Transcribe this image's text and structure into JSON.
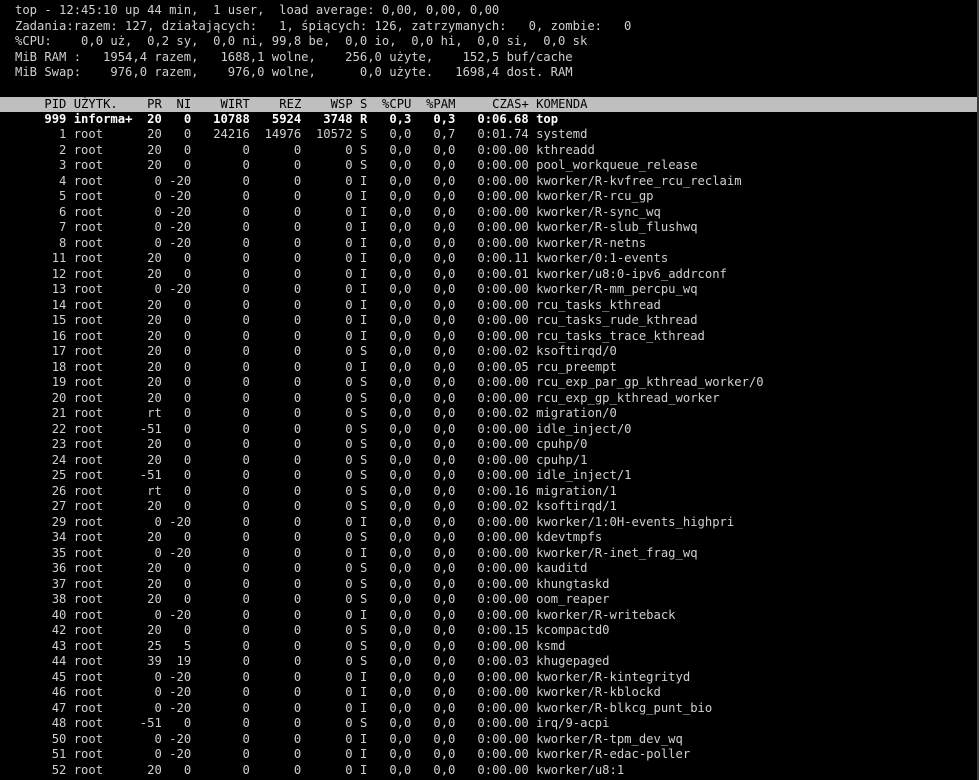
{
  "summary": {
    "line1": "top - 12:45:10 up 44 min,  1 user,  load average: 0,00, 0,00, 0,00",
    "line2": "Zadania:razem: 127, działających:   1, śpiących: 126, zatrzymanych:   0, zombie:   0",
    "line3": "%CPU:    0,0 uż,  0,2 sy,  0,0 ni, 99,8 be,  0,0 io,  0,0 hi,  0,0 si,  0,0 sk",
    "line4": "MiB RAM :   1954,4 razem,   1688,1 wolne,    256,0 użyte,    152,5 buf/cache",
    "line5": "MiB Swap:    976,0 razem,    976,0 wolne,      0,0 użyte.   1698,4 dost. RAM"
  },
  "columns": [
    "PID",
    "UŻYTK.",
    "PR",
    "NI",
    "WIRT",
    "REZ",
    "WSP",
    "S",
    "%CPU",
    "%PAM",
    "CZAS+",
    "KOMENDA"
  ],
  "processes": [
    [
      "999",
      "informa+",
      "20",
      "0",
      "10788",
      "5924",
      "3748",
      "R",
      "0,3",
      "0,3",
      "0:06.68",
      "top"
    ],
    [
      "1",
      "root",
      "20",
      "0",
      "24216",
      "14976",
      "10572",
      "S",
      "0,0",
      "0,7",
      "0:01.74",
      "systemd"
    ],
    [
      "2",
      "root",
      "20",
      "0",
      "0",
      "0",
      "0",
      "S",
      "0,0",
      "0,0",
      "0:00.00",
      "kthreadd"
    ],
    [
      "3",
      "root",
      "20",
      "0",
      "0",
      "0",
      "0",
      "S",
      "0,0",
      "0,0",
      "0:00.00",
      "pool_workqueue_release"
    ],
    [
      "4",
      "root",
      "0",
      "-20",
      "0",
      "0",
      "0",
      "I",
      "0,0",
      "0,0",
      "0:00.00",
      "kworker/R-kvfree_rcu_reclaim"
    ],
    [
      "5",
      "root",
      "0",
      "-20",
      "0",
      "0",
      "0",
      "I",
      "0,0",
      "0,0",
      "0:00.00",
      "kworker/R-rcu_gp"
    ],
    [
      "6",
      "root",
      "0",
      "-20",
      "0",
      "0",
      "0",
      "I",
      "0,0",
      "0,0",
      "0:00.00",
      "kworker/R-sync_wq"
    ],
    [
      "7",
      "root",
      "0",
      "-20",
      "0",
      "0",
      "0",
      "I",
      "0,0",
      "0,0",
      "0:00.00",
      "kworker/R-slub_flushwq"
    ],
    [
      "8",
      "root",
      "0",
      "-20",
      "0",
      "0",
      "0",
      "I",
      "0,0",
      "0,0",
      "0:00.00",
      "kworker/R-netns"
    ],
    [
      "11",
      "root",
      "20",
      "0",
      "0",
      "0",
      "0",
      "I",
      "0,0",
      "0,0",
      "0:00.11",
      "kworker/0:1-events"
    ],
    [
      "12",
      "root",
      "20",
      "0",
      "0",
      "0",
      "0",
      "I",
      "0,0",
      "0,0",
      "0:00.01",
      "kworker/u8:0-ipv6_addrconf"
    ],
    [
      "13",
      "root",
      "0",
      "-20",
      "0",
      "0",
      "0",
      "I",
      "0,0",
      "0,0",
      "0:00.00",
      "kworker/R-mm_percpu_wq"
    ],
    [
      "14",
      "root",
      "20",
      "0",
      "0",
      "0",
      "0",
      "I",
      "0,0",
      "0,0",
      "0:00.00",
      "rcu_tasks_kthread"
    ],
    [
      "15",
      "root",
      "20",
      "0",
      "0",
      "0",
      "0",
      "I",
      "0,0",
      "0,0",
      "0:00.00",
      "rcu_tasks_rude_kthread"
    ],
    [
      "16",
      "root",
      "20",
      "0",
      "0",
      "0",
      "0",
      "I",
      "0,0",
      "0,0",
      "0:00.00",
      "rcu_tasks_trace_kthread"
    ],
    [
      "17",
      "root",
      "20",
      "0",
      "0",
      "0",
      "0",
      "S",
      "0,0",
      "0,0",
      "0:00.02",
      "ksoftirqd/0"
    ],
    [
      "18",
      "root",
      "20",
      "0",
      "0",
      "0",
      "0",
      "I",
      "0,0",
      "0,0",
      "0:00.05",
      "rcu_preempt"
    ],
    [
      "19",
      "root",
      "20",
      "0",
      "0",
      "0",
      "0",
      "S",
      "0,0",
      "0,0",
      "0:00.00",
      "rcu_exp_par_gp_kthread_worker/0"
    ],
    [
      "20",
      "root",
      "20",
      "0",
      "0",
      "0",
      "0",
      "S",
      "0,0",
      "0,0",
      "0:00.00",
      "rcu_exp_gp_kthread_worker"
    ],
    [
      "21",
      "root",
      "rt",
      "0",
      "0",
      "0",
      "0",
      "S",
      "0,0",
      "0,0",
      "0:00.02",
      "migration/0"
    ],
    [
      "22",
      "root",
      "-51",
      "0",
      "0",
      "0",
      "0",
      "S",
      "0,0",
      "0,0",
      "0:00.00",
      "idle_inject/0"
    ],
    [
      "23",
      "root",
      "20",
      "0",
      "0",
      "0",
      "0",
      "S",
      "0,0",
      "0,0",
      "0:00.00",
      "cpuhp/0"
    ],
    [
      "24",
      "root",
      "20",
      "0",
      "0",
      "0",
      "0",
      "S",
      "0,0",
      "0,0",
      "0:00.00",
      "cpuhp/1"
    ],
    [
      "25",
      "root",
      "-51",
      "0",
      "0",
      "0",
      "0",
      "S",
      "0,0",
      "0,0",
      "0:00.00",
      "idle_inject/1"
    ],
    [
      "26",
      "root",
      "rt",
      "0",
      "0",
      "0",
      "0",
      "S",
      "0,0",
      "0,0",
      "0:00.16",
      "migration/1"
    ],
    [
      "27",
      "root",
      "20",
      "0",
      "0",
      "0",
      "0",
      "S",
      "0,0",
      "0,0",
      "0:00.02",
      "ksoftirqd/1"
    ],
    [
      "29",
      "root",
      "0",
      "-20",
      "0",
      "0",
      "0",
      "I",
      "0,0",
      "0,0",
      "0:00.00",
      "kworker/1:0H-events_highpri"
    ],
    [
      "34",
      "root",
      "20",
      "0",
      "0",
      "0",
      "0",
      "S",
      "0,0",
      "0,0",
      "0:00.00",
      "kdevtmpfs"
    ],
    [
      "35",
      "root",
      "0",
      "-20",
      "0",
      "0",
      "0",
      "I",
      "0,0",
      "0,0",
      "0:00.00",
      "kworker/R-inet_frag_wq"
    ],
    [
      "36",
      "root",
      "20",
      "0",
      "0",
      "0",
      "0",
      "S",
      "0,0",
      "0,0",
      "0:00.00",
      "kauditd"
    ],
    [
      "37",
      "root",
      "20",
      "0",
      "0",
      "0",
      "0",
      "S",
      "0,0",
      "0,0",
      "0:00.00",
      "khungtaskd"
    ],
    [
      "38",
      "root",
      "20",
      "0",
      "0",
      "0",
      "0",
      "S",
      "0,0",
      "0,0",
      "0:00.00",
      "oom_reaper"
    ],
    [
      "40",
      "root",
      "0",
      "-20",
      "0",
      "0",
      "0",
      "I",
      "0,0",
      "0,0",
      "0:00.00",
      "kworker/R-writeback"
    ],
    [
      "42",
      "root",
      "20",
      "0",
      "0",
      "0",
      "0",
      "S",
      "0,0",
      "0,0",
      "0:00.15",
      "kcompactd0"
    ],
    [
      "43",
      "root",
      "25",
      "5",
      "0",
      "0",
      "0",
      "S",
      "0,0",
      "0,0",
      "0:00.00",
      "ksmd"
    ],
    [
      "44",
      "root",
      "39",
      "19",
      "0",
      "0",
      "0",
      "S",
      "0,0",
      "0,0",
      "0:00.03",
      "khugepaged"
    ],
    [
      "45",
      "root",
      "0",
      "-20",
      "0",
      "0",
      "0",
      "I",
      "0,0",
      "0,0",
      "0:00.00",
      "kworker/R-kintegrityd"
    ],
    [
      "46",
      "root",
      "0",
      "-20",
      "0",
      "0",
      "0",
      "I",
      "0,0",
      "0,0",
      "0:00.00",
      "kworker/R-kblockd"
    ],
    [
      "47",
      "root",
      "0",
      "-20",
      "0",
      "0",
      "0",
      "I",
      "0,0",
      "0,0",
      "0:00.00",
      "kworker/R-blkcg_punt_bio"
    ],
    [
      "48",
      "root",
      "-51",
      "0",
      "0",
      "0",
      "0",
      "S",
      "0,0",
      "0,0",
      "0:00.00",
      "irq/9-acpi"
    ],
    [
      "50",
      "root",
      "0",
      "-20",
      "0",
      "0",
      "0",
      "I",
      "0,0",
      "0,0",
      "0:00.00",
      "kworker/R-tpm_dev_wq"
    ],
    [
      "51",
      "root",
      "0",
      "-20",
      "0",
      "0",
      "0",
      "I",
      "0,0",
      "0,0",
      "0:00.00",
      "kworker/R-edac-poller"
    ],
    [
      "52",
      "root",
      "20",
      "0",
      "0",
      "0",
      "0",
      "I",
      "0,0",
      "0,0",
      "0:00.00",
      "kworker/u8:1"
    ]
  ],
  "colors": {
    "background": "#000000",
    "text": "#d0d0d0",
    "header_bg": "#bfbfbf",
    "header_text": "#000000",
    "running_text": "#ffffff"
  }
}
